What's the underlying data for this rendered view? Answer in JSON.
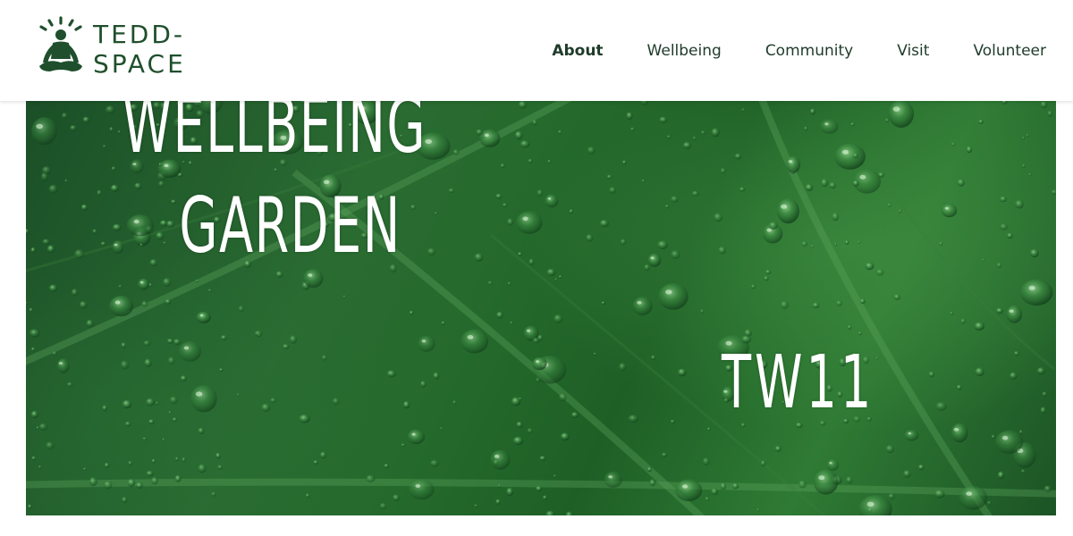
{
  "brand": {
    "line1": "TEDD-",
    "line2": "SPACE",
    "icon": "meditating-person-icon"
  },
  "nav": {
    "items": [
      {
        "label": "About",
        "active": true
      },
      {
        "label": "Wellbeing",
        "active": false
      },
      {
        "label": "Community",
        "active": false
      },
      {
        "label": "Visit",
        "active": false
      },
      {
        "label": "Volunteer",
        "active": false
      }
    ]
  },
  "hero": {
    "title_line1": "WELLBEING",
    "title_line2": "GARDEN",
    "postcode": "TW11",
    "background": "green-leaf-water-droplets-image"
  },
  "colors": {
    "brand": "#1f4f2c",
    "nav_text": "#1f3b2a",
    "hero_text": "#ffffff"
  }
}
